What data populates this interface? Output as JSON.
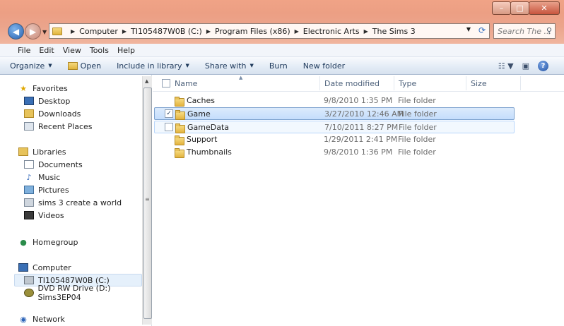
{
  "window": {
    "minimize_label": "–",
    "maximize_label": "□",
    "close_label": "✕"
  },
  "address": {
    "breadcrumbs": [
      "Computer",
      "TI105487W0B (C:)",
      "Program Files (x86)",
      "Electronic Arts",
      "The Sims 3"
    ]
  },
  "search": {
    "placeholder": "Search The ..."
  },
  "menu": [
    "File",
    "Edit",
    "View",
    "Tools",
    "Help"
  ],
  "toolbar": {
    "organize": "Organize",
    "open": "Open",
    "include": "Include in library",
    "share": "Share with",
    "burn": "Burn",
    "newfolder": "New folder"
  },
  "nav": {
    "favorites": "Favorites",
    "desktop": "Desktop",
    "downloads": "Downloads",
    "recent": "Recent Places",
    "libraries": "Libraries",
    "documents": "Documents",
    "music": "Music",
    "pictures": "Pictures",
    "sims_world": "sims 3 create a world",
    "videos": "Videos",
    "homegroup": "Homegroup",
    "computer": "Computer",
    "drive_c": "TI105487W0B (C:)",
    "drive_d": "DVD RW Drive (D:) Sims3EP04",
    "network": "Network"
  },
  "columns": {
    "name": "Name",
    "date": "Date modified",
    "type": "Type",
    "size": "Size"
  },
  "files": [
    {
      "name": "Caches",
      "date": "9/8/2010 1:35 PM",
      "type": "File folder"
    },
    {
      "name": "Game",
      "date": "3/27/2010 12:46 AM",
      "type": "File folder"
    },
    {
      "name": "GameData",
      "date": "7/10/2011 8:27 PM",
      "type": "File folder"
    },
    {
      "name": "Support",
      "date": "1/29/2011 2:41 PM",
      "type": "File folder"
    },
    {
      "name": "Thumbnails",
      "date": "9/8/2010 1:36 PM",
      "type": "File folder"
    }
  ]
}
